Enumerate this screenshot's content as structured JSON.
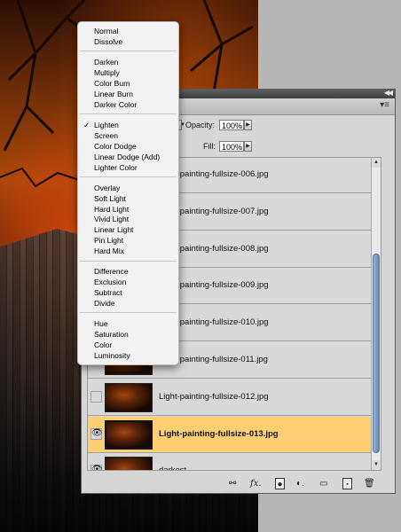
{
  "panel": {
    "opacity_label": "Opacity:",
    "opacity_value": "100%",
    "fill_label": "Fill:",
    "fill_value": "100%",
    "layers": [
      {
        "name": "Light-painting-fullsize-006.jpg",
        "visible": false,
        "selected": false
      },
      {
        "name": "Light-painting-fullsize-007.jpg",
        "visible": false,
        "selected": false
      },
      {
        "name": "Light-painting-fullsize-008.jpg",
        "visible": false,
        "selected": false
      },
      {
        "name": "Light-painting-fullsize-009.jpg",
        "visible": false,
        "selected": false
      },
      {
        "name": "Light-painting-fullsize-010.jpg",
        "visible": false,
        "selected": false
      },
      {
        "name": "Light-painting-fullsize-011.jpg",
        "visible": false,
        "selected": false
      },
      {
        "name": "Light-painting-fullsize-012.jpg",
        "visible": false,
        "selected": false
      },
      {
        "name": "Light-painting-fullsize-013.jpg",
        "visible": true,
        "selected": true
      },
      {
        "name": "darkest",
        "visible": true,
        "selected": false
      }
    ],
    "bottom_icons": [
      "link-icon",
      "fx-icon",
      "mask-icon",
      "adjustment-icon",
      "folder-icon",
      "new-layer-icon",
      "trash-icon"
    ],
    "selected_color": "#fdcf72"
  },
  "blend_menu": {
    "selected": "Lighten",
    "groups": [
      [
        "Normal",
        "Dissolve"
      ],
      [
        "Darken",
        "Multiply",
        "Color Burn",
        "Linear Burn",
        "Darker Color"
      ],
      [
        "Lighten",
        "Screen",
        "Color Dodge",
        "Linear Dodge (Add)",
        "Lighter Color"
      ],
      [
        "Overlay",
        "Soft Light",
        "Hard Light",
        "Vivid Light",
        "Linear Light",
        "Pin Light",
        "Hard Mix"
      ],
      [
        "Difference",
        "Exclusion",
        "Subtract",
        "Divide"
      ],
      [
        "Hue",
        "Saturation",
        "Color",
        "Luminosity"
      ]
    ]
  }
}
